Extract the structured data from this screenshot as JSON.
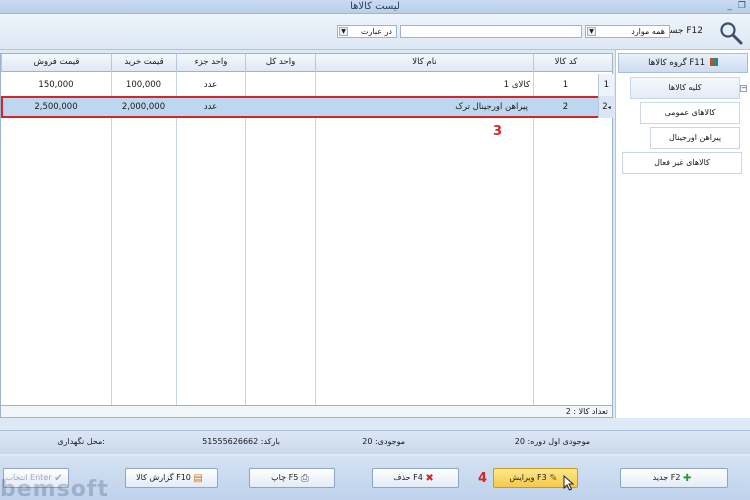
{
  "window": {
    "title": "لیست کالاها",
    "controls": [
      "_",
      "❐"
    ]
  },
  "search": {
    "label": "جستجو F12",
    "scope_value": "همه موارد",
    "mode_value": "در عبارت",
    "query_value": ""
  },
  "groups": {
    "header": "گروه کالاها F11",
    "items": [
      {
        "label": "کلیه کالاها",
        "selected": true
      },
      {
        "label": "کالاهای عمومی"
      },
      {
        "label": "پیراهن اورجینال"
      },
      {
        "label": "کالاهای غیر فعال"
      }
    ]
  },
  "table": {
    "columns": [
      "کد کالا",
      "نام کالا",
      "واحد کل",
      "واحد جزء",
      "قیمت خرید",
      "قیمت فروش"
    ],
    "rows": [
      {
        "num": "1",
        "code": "1",
        "name": "کالای 1",
        "unit_total": "",
        "unit_part": "عدد",
        "buy": "100,000",
        "sell": "150,000"
      },
      {
        "num": "2",
        "code": "2",
        "name": "پیراهن اورجینال ترک",
        "unit_total": "",
        "unit_part": "عدد",
        "buy": "2,000,000",
        "sell": "2,500,000",
        "selected": true
      }
    ],
    "count_label": "تعداد کالا : 2"
  },
  "annotations": {
    "step3": "3",
    "step4": "4"
  },
  "status": {
    "initial_stock": "موجودی اول دوره: 20",
    "stock": "موجودی: 20",
    "barcode": "بارکد: 51555626662",
    "location": "محل نگهداری:"
  },
  "toolbar": {
    "new": "جدید F2",
    "edit": "ویرایش F3",
    "delete": "حذف F4",
    "print": "چاپ F5",
    "report": "گزارش کالا F10",
    "select": "انتخاب Enter"
  },
  "watermark": "bemsoft",
  "colors": {
    "selection": "#bcd7ef",
    "highlight": "#d62525",
    "active_button": "#f6c94a"
  }
}
